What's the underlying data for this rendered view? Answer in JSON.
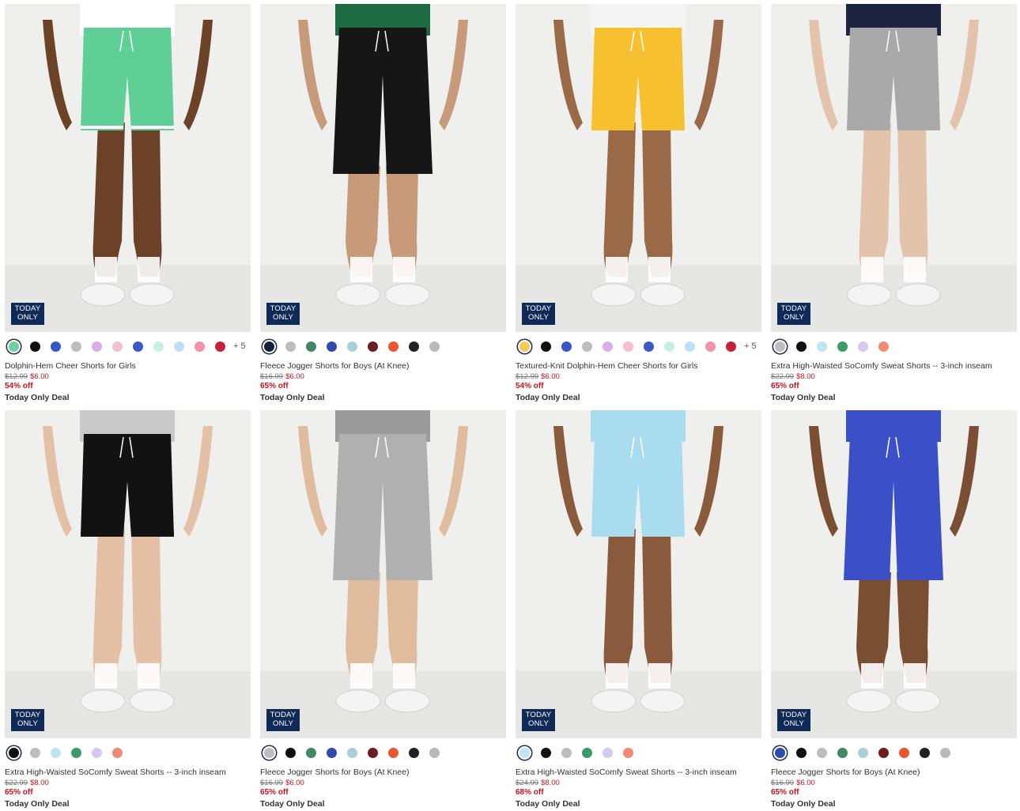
{
  "products": [
    {
      "name": "Dolphin-Hem Cheer Shorts for Girls",
      "badge": "TODAY\nONLY",
      "old_price": "$12.99",
      "new_price": "$6.00",
      "discount": "54% off",
      "deal": "Today Only Deal",
      "more_colors": "+ 5",
      "short_color": "#5fcf95",
      "trim_color": "#ffffff",
      "skin": "#6b4228",
      "bg": "#efefee",
      "top_color": "#ffffff",
      "swatches": [
        "#6fd0a0",
        "#111111",
        "#3a55c4",
        "#bdbdbd",
        "#d9aee6",
        "#f4bfcf",
        "#3d57c9",
        "#c8f0e2",
        "#bde0f5",
        "#ef93a6",
        "#c7203b"
      ]
    },
    {
      "name": "Fleece Jogger Shorts for Boys (At Knee)",
      "badge": "TODAY\nONLY",
      "old_price": "$16.99",
      "new_price": "$6.00",
      "discount": "65% off",
      "deal": "Today Only Deal",
      "more_colors": "",
      "short_color": "#161616",
      "trim_color": "#161616",
      "skin": "#c79a7a",
      "bg": "#efefee",
      "top_color": "#1d6b43",
      "swatches": [
        "#15203d",
        "#bdbdbd",
        "#3e8a66",
        "#2f4bb0",
        "#a9cfd8",
        "#6d1c22",
        "#e8572e",
        "#222222",
        "#b9b9b9"
      ]
    },
    {
      "name": "Textured-Knit Dolphin-Hem Cheer Shorts for Girls",
      "badge": "TODAY\nONLY",
      "old_price": "$12.99",
      "new_price": "$6.00",
      "discount": "54% off",
      "deal": "Today Only Deal",
      "more_colors": "+ 5",
      "short_color": "#f6c02e",
      "trim_color": "#f6c02e",
      "skin": "#9a6a48",
      "bg": "#efefee",
      "top_color": "#f4f4f4",
      "swatches": [
        "#f5cb55",
        "#111111",
        "#3a55c4",
        "#bdbdbd",
        "#d9aee6",
        "#f4bfcf",
        "#3d57c9",
        "#c8f0e2",
        "#bde0f5",
        "#ef93a6",
        "#c7203b"
      ]
    },
    {
      "name": "Extra High-Waisted SoComfy Sweat Shorts -- 3-inch inseam",
      "badge": "TODAY\nONLY",
      "old_price": "$22.99",
      "new_price": "$8.00",
      "discount": "65% off",
      "deal": "Today Only Deal",
      "more_colors": "",
      "short_color": "#a9a9a9",
      "trim_color": "#a9a9a9",
      "skin": "#e3c3ab",
      "bg": "#efefee",
      "top_color": "#1c2440",
      "swatches": [
        "#bdbdbd",
        "#111111",
        "#bfe4f2",
        "#3a9a6a",
        "#d8c7ef",
        "#f08a73"
      ]
    },
    {
      "name": "Extra High-Waisted SoComfy Sweat Shorts -- 3-inch inseam",
      "badge": "TODAY\nONLY",
      "old_price": "$22.99",
      "new_price": "$8.00",
      "discount": "65% off",
      "deal": "Today Only Deal",
      "more_colors": "",
      "short_color": "#121212",
      "trim_color": "#121212",
      "skin": "#e3c0a6",
      "bg": "#efefee",
      "top_color": "#c9c9c9",
      "swatches": [
        "#111111",
        "#bdbdbd",
        "#bfe4f2",
        "#3a9a6a",
        "#d8c7ef",
        "#f08a73"
      ]
    },
    {
      "name": "Fleece Jogger Shorts for Boys (At Knee)",
      "badge": "TODAY\nONLY",
      "old_price": "$16.99",
      "new_price": "$6.00",
      "discount": "65% off",
      "deal": "Today Only Deal",
      "more_colors": "",
      "short_color": "#b0b0b0",
      "trim_color": "#b0b0b0",
      "skin": "#e0bc9f",
      "bg": "#efefee",
      "top_color": "#9a9a9a",
      "swatches": [
        "#bdbdbd",
        "#111111",
        "#3e8a66",
        "#2f4bb0",
        "#a9cfd8",
        "#6d1c22",
        "#e8572e",
        "#222222",
        "#b9b9b9"
      ]
    },
    {
      "name": "Extra High-Waisted SoComfy Sweat Shorts -- 3-inch inseam",
      "badge": "TODAY\nONLY",
      "old_price": "$24.99",
      "new_price": "$8.00",
      "discount": "68% off",
      "deal": "Today Only Deal",
      "more_colors": "",
      "short_color": "#a8dcee",
      "trim_color": "#a8dcee",
      "skin": "#8a5a3c",
      "bg": "#efefee",
      "top_color": "#a8dcee",
      "swatches": [
        "#bfe4f2",
        "#111111",
        "#bdbdbd",
        "#3a9a6a",
        "#d8c7ef",
        "#f08a73"
      ]
    },
    {
      "name": "Fleece Jogger Shorts for Boys (At Knee)",
      "badge": "TODAY\nONLY",
      "old_price": "$16.99",
      "new_price": "$6.00",
      "discount": "65% off",
      "deal": "Today Only Deal",
      "more_colors": "",
      "short_color": "#3b4fc6",
      "trim_color": "#3b4fc6",
      "skin": "#7a4e32",
      "bg": "#efefee",
      "top_color": "#3b4fc6",
      "swatches": [
        "#2f4bb0",
        "#111111",
        "#bdbdbd",
        "#3e8a66",
        "#a9cfd8",
        "#6d1c22",
        "#e8572e",
        "#222222",
        "#b9b9b9"
      ]
    }
  ]
}
